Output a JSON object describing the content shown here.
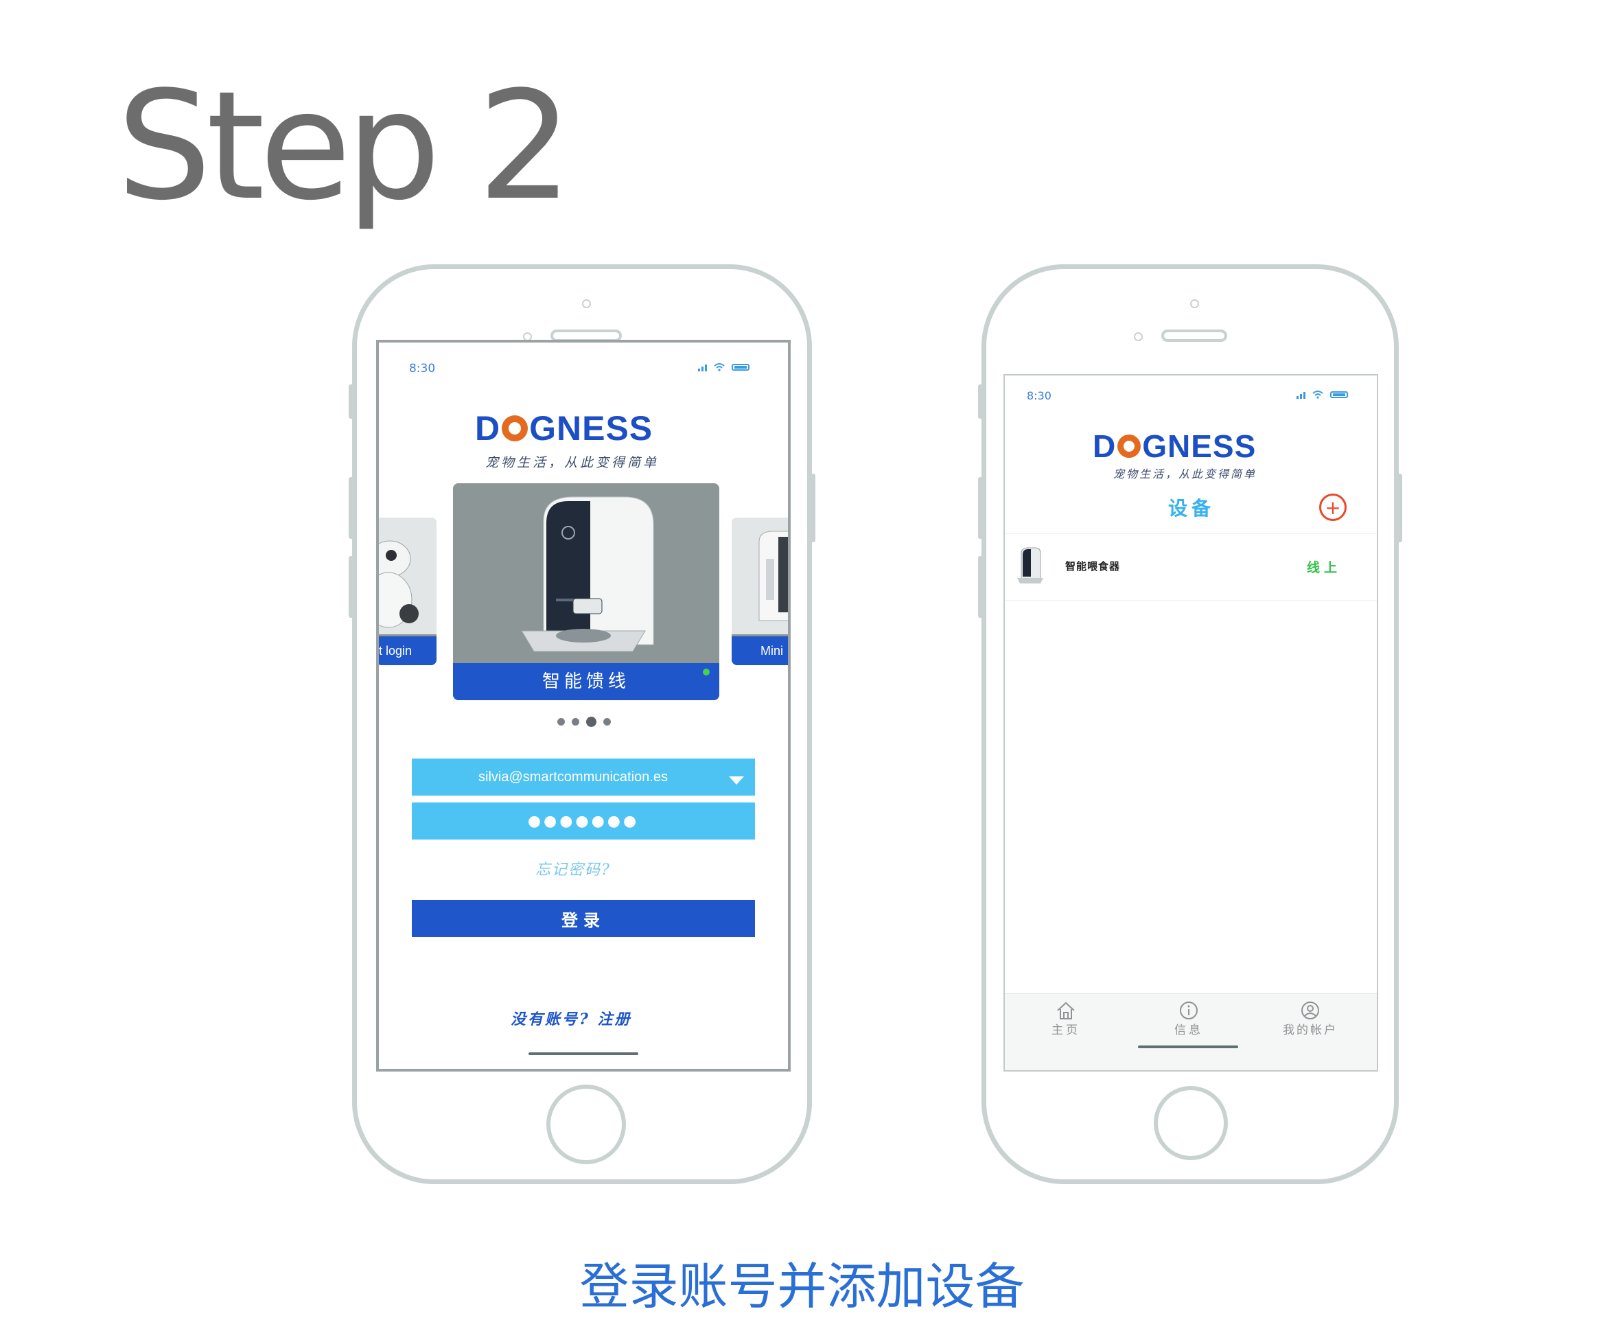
{
  "page": {
    "title": "Step 2",
    "caption": "登录账号并添加设备"
  },
  "colors": {
    "brand_blue": "#1f56c9",
    "field_blue": "#4dc3f3",
    "brand_orange": "#e36a1e",
    "online_green": "#36c24a",
    "add_red": "#e8492c"
  },
  "login_screen": {
    "status_time": "8:30",
    "logo": {
      "prefix": "D",
      "suffix": "GNESS"
    },
    "tagline": "宠物生活，从此变得简单",
    "carousel": {
      "left_label": "t login",
      "center_label": "智能馈线",
      "right_label": "Mini",
      "page_count": 4,
      "active_index": 2
    },
    "email": "silvia@smartcommunication.es",
    "password_masked": "●●●●●●●",
    "forgot_password": "忘记密码?",
    "login_button": "登录",
    "register_prompt": "没有账号? 注册"
  },
  "devices_screen": {
    "status_time": "8:30",
    "logo": {
      "prefix": "D",
      "suffix": "GNESS"
    },
    "tagline": "宠物生活，从此变得简单",
    "title": "设备",
    "add_icon": "plus-circle-icon",
    "devices": [
      {
        "name": "智能喂食器",
        "status": "线上"
      }
    ],
    "tabs": [
      {
        "label": "主页",
        "icon": "home-icon"
      },
      {
        "label": "信息",
        "icon": "info-icon"
      },
      {
        "label": "我的帐户",
        "icon": "account-icon"
      }
    ]
  }
}
